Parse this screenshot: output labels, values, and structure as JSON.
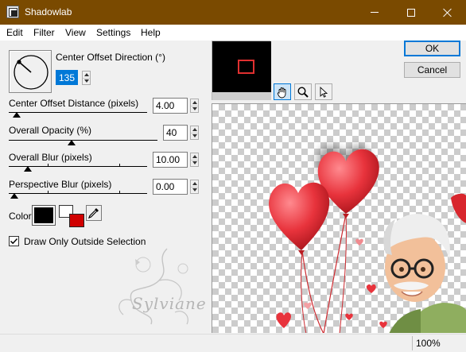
{
  "window": {
    "title": "Shadowlab"
  },
  "menu": {
    "items": [
      "Edit",
      "Filter",
      "View",
      "Settings",
      "Help"
    ]
  },
  "direction": {
    "label": "Center Offset Direction (°)",
    "value": "135"
  },
  "distance": {
    "label": "Center Offset Distance (pixels)",
    "value": "4.00",
    "slider_fraction": 0.02
  },
  "opacity": {
    "label": "Overall Opacity (%)",
    "value": "40",
    "slider_fraction": 0.4
  },
  "blur": {
    "label": "Overall Blur (pixels)",
    "value": "10.00",
    "slider_fraction": 0.1
  },
  "perspective_blur": {
    "label": "Perspective Blur (pixels)",
    "value": "0.00",
    "slider_fraction": 0.0
  },
  "color": {
    "label": "Color",
    "primary": "#000000",
    "secondary": "#d00000"
  },
  "draw_only_outside": {
    "label": "Draw Only Outside Selection",
    "checked": true
  },
  "buttons": {
    "ok": "OK",
    "cancel": "Cancel"
  },
  "tools": [
    "hand-icon",
    "zoom-icon",
    "arrow-icon"
  ],
  "watermark": {
    "text": "Sylviane"
  },
  "status": {
    "zoom": "100%"
  },
  "colors": {
    "titlebar": "#7a4a00",
    "accent": "#0078d7",
    "heart": "#e8333c"
  }
}
